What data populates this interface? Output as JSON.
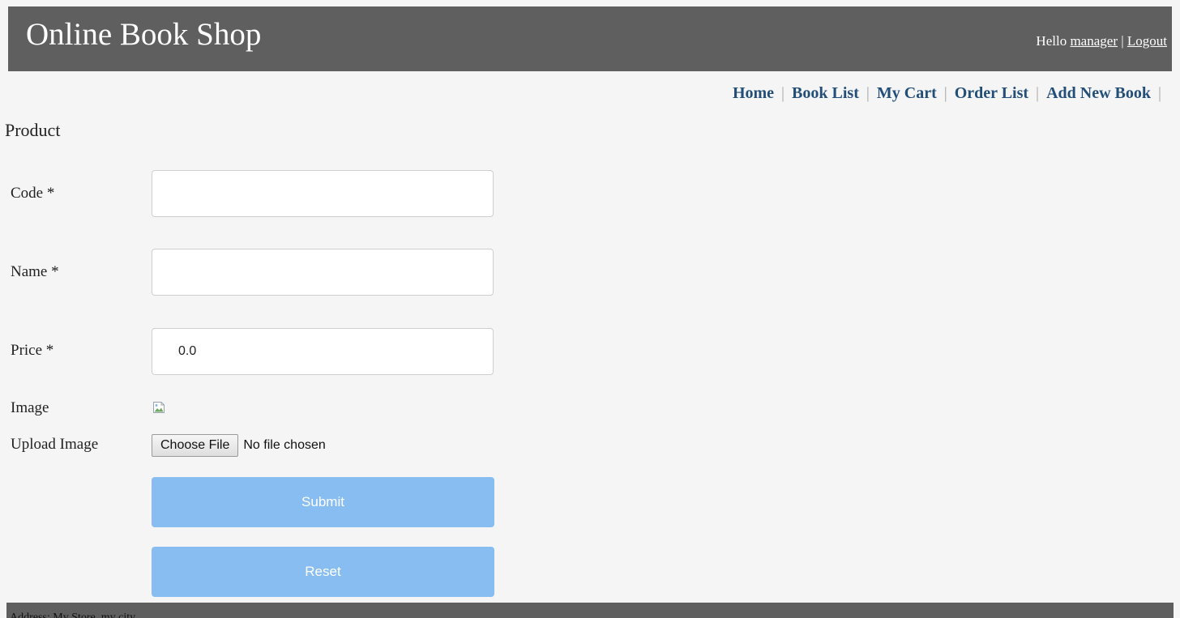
{
  "header": {
    "site_title": "Online Book Shop",
    "greeting": "Hello",
    "username": "manager",
    "separator": "|",
    "logout": "Logout"
  },
  "menu": {
    "items": [
      "Home",
      "Book List",
      "My Cart",
      "Order List",
      "Add New Book"
    ],
    "separator": "|"
  },
  "form": {
    "title": "Product",
    "code_label": "Code *",
    "code_value": "",
    "name_label": "Name *",
    "name_value": "",
    "price_label": "Price *",
    "price_value": "0.0",
    "image_label": "Image",
    "upload_label": "Upload Image",
    "choose_file": "Choose File",
    "file_status": "No file chosen",
    "submit": "Submit",
    "reset": "Reset"
  },
  "footer": {
    "text": "Address: My Store, my city"
  },
  "colors": {
    "header_bg": "#5f5f5f",
    "menu_link": "#224e78",
    "button_bg": "#88bdf2",
    "page_bg": "#f5f5f5"
  },
  "icons": {
    "image_placeholder": "broken-image-icon"
  }
}
